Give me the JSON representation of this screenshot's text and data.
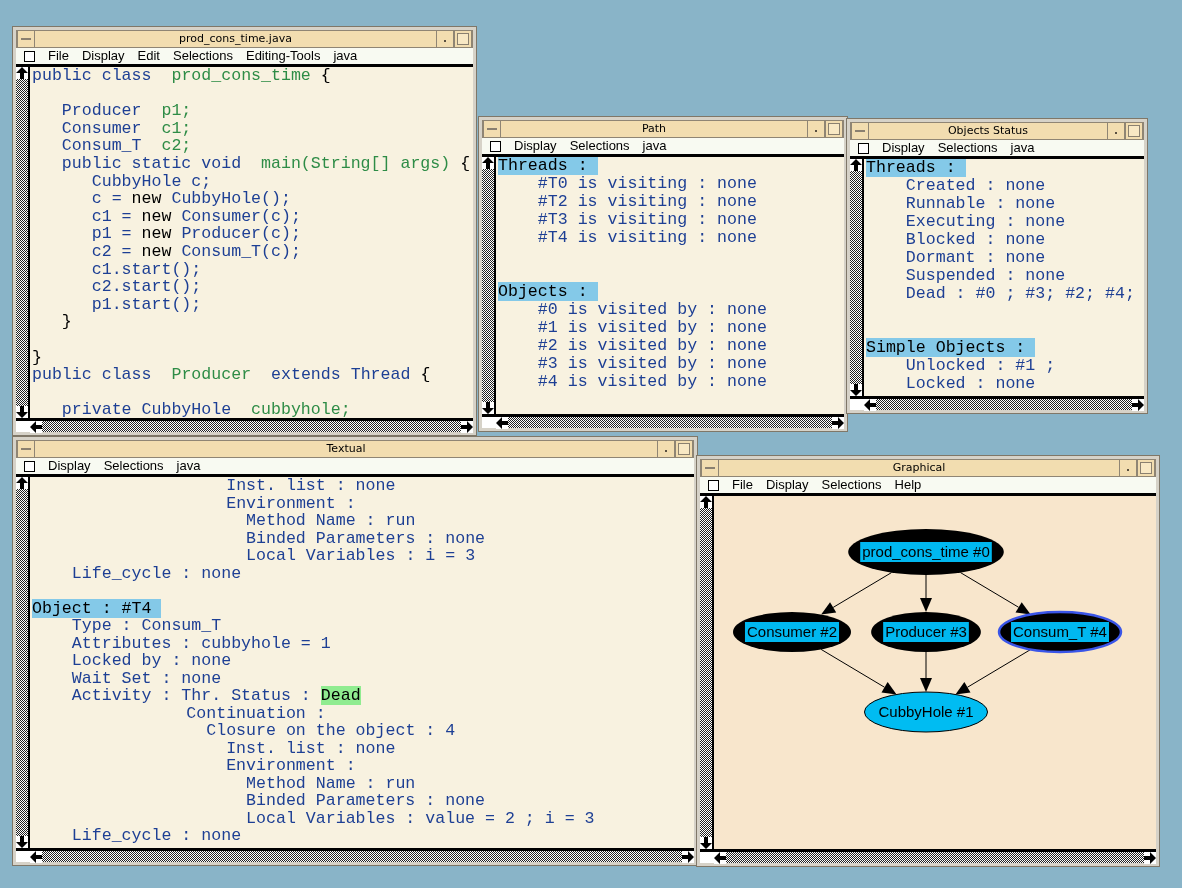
{
  "windows": [
    {
      "kind": "editor",
      "title": "prod_cons_time.java",
      "menu": [
        "File",
        "Display",
        "Edit",
        "Selections",
        "Editing-Tools",
        "java"
      ],
      "code": [
        {
          "kind": "code",
          "segments": [
            {
              "kind": "type",
              "text": "public class  "
            },
            {
              "kind": "name",
              "text": "prod_cons_time"
            },
            {
              "kind": "plain",
              "text": " {"
            }
          ]
        },
        {
          "kind": "blank"
        },
        {
          "kind": "code",
          "segments": [
            {
              "kind": "type",
              "text": "   Producer  "
            },
            {
              "kind": "name",
              "text": "p1;"
            }
          ]
        },
        {
          "kind": "code",
          "segments": [
            {
              "kind": "type",
              "text": "   Consumer  "
            },
            {
              "kind": "name",
              "text": "c1;"
            }
          ]
        },
        {
          "kind": "code",
          "segments": [
            {
              "kind": "type",
              "text": "   Consum_T  "
            },
            {
              "kind": "name",
              "text": "c2;"
            }
          ]
        },
        {
          "kind": "code",
          "segments": [
            {
              "kind": "type",
              "text": "   public static void  "
            },
            {
              "kind": "name",
              "text": "main(String[] args)"
            },
            {
              "kind": "plain",
              "text": " {"
            }
          ]
        },
        {
          "kind": "code",
          "segments": [
            {
              "kind": "type",
              "text": "      CubbyHole c;"
            }
          ]
        },
        {
          "kind": "code",
          "segments": [
            {
              "kind": "type",
              "text": "      c = "
            },
            {
              "kind": "plain",
              "text": "new"
            },
            {
              "kind": "type",
              "text": " CubbyHole();"
            }
          ]
        },
        {
          "kind": "code",
          "segments": [
            {
              "kind": "type",
              "text": "      c1 = "
            },
            {
              "kind": "plain",
              "text": "new"
            },
            {
              "kind": "type",
              "text": " Consumer(c);"
            }
          ]
        },
        {
          "kind": "code",
          "segments": [
            {
              "kind": "type",
              "text": "      p1 = "
            },
            {
              "kind": "plain",
              "text": "new"
            },
            {
              "kind": "type",
              "text": " Producer(c);"
            }
          ]
        },
        {
          "kind": "code",
          "segments": [
            {
              "kind": "type",
              "text": "      c2 = "
            },
            {
              "kind": "plain",
              "text": "new"
            },
            {
              "kind": "type",
              "text": " Consum_T(c);"
            }
          ]
        },
        {
          "kind": "code",
          "segments": [
            {
              "kind": "type",
              "text": "      c1.start();"
            }
          ]
        },
        {
          "kind": "code",
          "segments": [
            {
              "kind": "type",
              "text": "      c2.start();"
            }
          ]
        },
        {
          "kind": "code",
          "segments": [
            {
              "kind": "type",
              "text": "      p1.start();"
            }
          ]
        },
        {
          "kind": "code",
          "segments": [
            {
              "kind": "plain",
              "text": "   }"
            }
          ]
        },
        {
          "kind": "blank"
        },
        {
          "kind": "code",
          "segments": [
            {
              "kind": "plain",
              "text": "}"
            }
          ]
        },
        {
          "kind": "code",
          "segments": [
            {
              "kind": "type",
              "text": "public class  "
            },
            {
              "kind": "name",
              "text": "Producer"
            },
            {
              "kind": "type",
              "text": "  extends Thread"
            },
            {
              "kind": "plain",
              "text": " {"
            }
          ]
        },
        {
          "kind": "blank"
        },
        {
          "kind": "code",
          "segments": [
            {
              "kind": "type",
              "text": "   private CubbyHole  "
            },
            {
              "kind": "name",
              "text": "cubbyhole;"
            }
          ]
        }
      ]
    },
    {
      "kind": "path",
      "title": "Path",
      "menu": [
        "Display",
        "Selections",
        "java"
      ],
      "sections": [
        {
          "title": "Threads :",
          "items": [
            "#T0 is visiting : none",
            "#T2 is visiting : none",
            "#T3 is visiting : none",
            "#T4 is visiting : none"
          ]
        },
        {
          "title": "Objects :",
          "items": [
            "#0 is visited by : none",
            "#1 is visited by : none",
            "#2 is visited by : none",
            "#3 is visited by : none",
            "#4 is visited by : none"
          ]
        }
      ]
    },
    {
      "kind": "status",
      "title": "Objects Status",
      "menu": [
        "Display",
        "Selections",
        "java"
      ],
      "sections": [
        {
          "title": "Threads :",
          "items": [
            "Created : none",
            "Runnable : none",
            "Executing : none",
            "Blocked : none",
            "Dormant : none",
            "Suspended : none",
            "Dead : #0 ; #3; #2; #4;"
          ]
        },
        {
          "title": "Simple Objects :",
          "items": [
            "Unlocked : #1 ;",
            "Locked : none"
          ]
        }
      ]
    },
    {
      "kind": "textual",
      "title": "Textual",
      "menu": [
        "Display",
        "Selections",
        "java"
      ],
      "listing": {
        "continued": [
          {
            "text": "Inst. list : none"
          },
          {
            "text": "Environment :",
            "children": [
              {
                "text": "Method Name : run"
              },
              {
                "text": "Binded Parameters : none"
              },
              {
                "text": "Local Variables : i = 3"
              }
            ]
          }
        ],
        "tail": "Life_cycle : none",
        "objects": [
          {
            "header": "Object : #T4",
            "entries": [
              {
                "text": "Type : Consum_T"
              },
              {
                "text": "Attributes : cubbyhole = 1"
              },
              {
                "text": "Locked by : none"
              },
              {
                "text": "Wait Set : none"
              },
              {
                "text": "Activity : Thr. Status :",
                "status": "Dead",
                "children": [
                  {
                    "text": "Continuation :",
                    "children": [
                      {
                        "text": "Closure on the object : 4",
                        "children": [
                          {
                            "text": "Inst. list : none"
                          },
                          {
                            "text": "Environment :",
                            "children": [
                              {
                                "text": "Method Name : run"
                              },
                              {
                                "text": "Binded Parameters : none"
                              },
                              {
                                "text": "Local Variables : value = 2 ; i = 3"
                              }
                            ]
                          }
                        ]
                      }
                    ]
                  }
                ]
              },
              {
                "text": "Life_cycle : none"
              }
            ]
          }
        ]
      }
    },
    {
      "kind": "graphical",
      "title": "Graphical",
      "menu": [
        "File",
        "Display",
        "Selections",
        "Help"
      ],
      "graph": {
        "layers": [
          {
            "nodes": [
              {
                "label": "prod_cons_time #0",
                "kind": "thread",
                "selected": false
              }
            ]
          },
          {
            "nodes": [
              {
                "label": "Consumer #2",
                "kind": "thread",
                "selected": false
              },
              {
                "label": "Producer #3",
                "kind": "thread",
                "selected": false
              },
              {
                "label": "Consum_T #4",
                "kind": "thread",
                "selected": true
              }
            ]
          },
          {
            "nodes": [
              {
                "label": "CubbyHole #1",
                "kind": "object",
                "selected": false
              }
            ]
          }
        ]
      }
    }
  ]
}
